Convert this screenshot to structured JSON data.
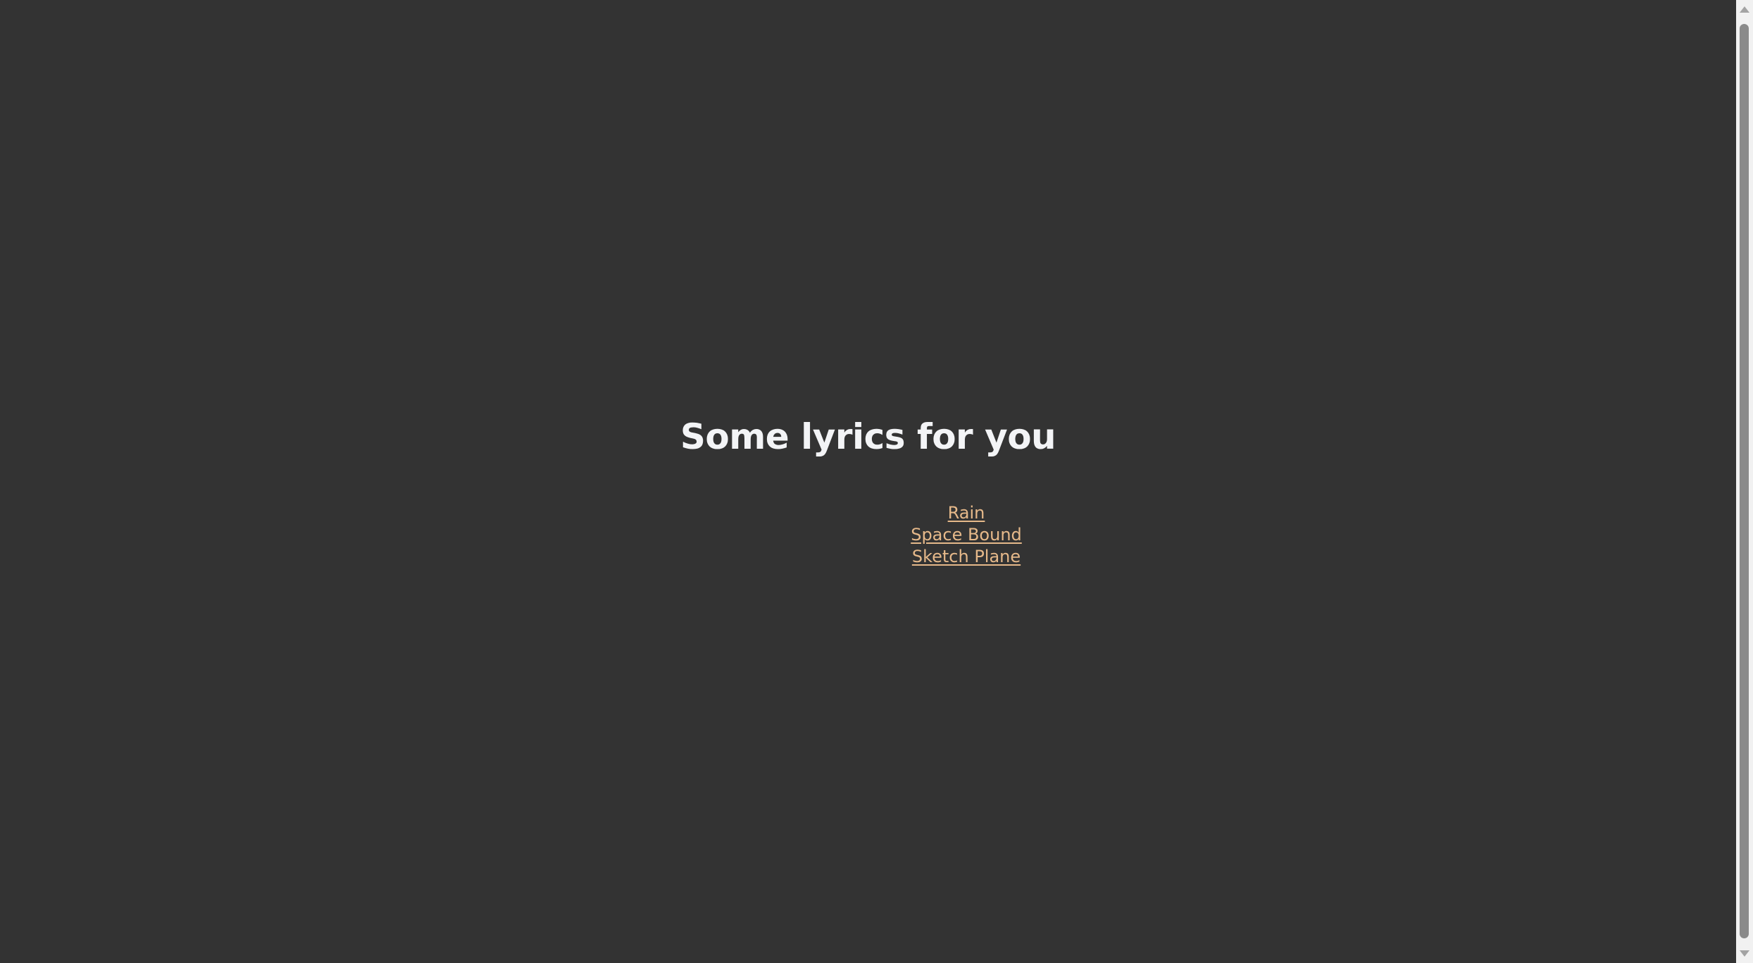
{
  "page": {
    "title": "Some lyrics for you",
    "songs": [
      {
        "label": "Rain"
      },
      {
        "label": "Space Bound"
      },
      {
        "label": "Sketch Plane"
      }
    ]
  },
  "colors": {
    "background": "#333333",
    "heading": "#f3f4f6",
    "link": "#e6b98a"
  }
}
